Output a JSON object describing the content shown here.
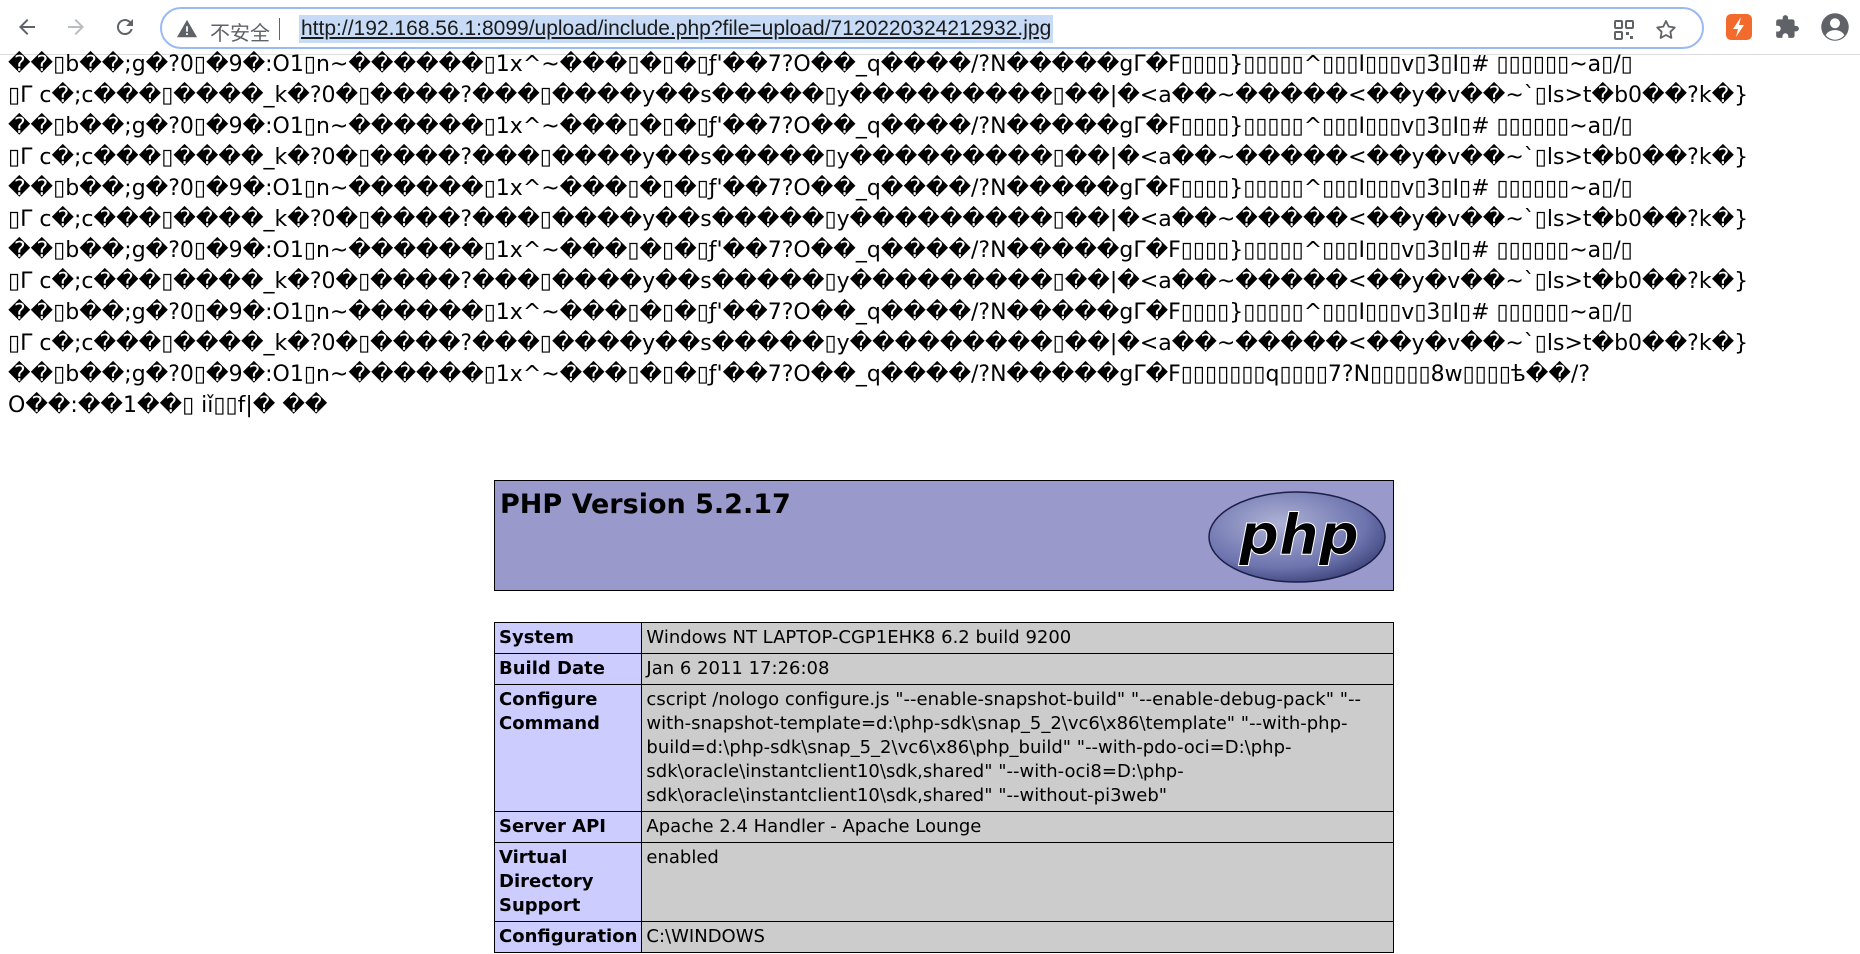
{
  "browser": {
    "insecure_label": "不安全",
    "url": "http://192.168.56.1:8099/upload/include.php?file=upload/7120220324212932.jpg",
    "icons": [
      "back-icon",
      "forward-icon",
      "reload-icon",
      "warning-icon",
      "qr-icon",
      "star-icon",
      "extension-flash-icon",
      "puzzle-icon",
      "account-icon"
    ],
    "colors": {
      "url_highlight": "#c7dbf7",
      "omnibox_border": "#9bb9f2",
      "ext_orange": "#f26b2c"
    }
  },
  "garbage_lines": [
    "��▯b��;g�?0▯�9�:O1▯n~������▯1x^~���▯�▯�▯ƒ'��7?O��_q����/?N�����gΓ�F▯▯▯▯}▯▯▯▯▯^▯▯▯I▯▯▯v▯3▯I▯# ▯▯▯▯▯▯~a▯/▯",
    "▯Γ c�;c���▯����_k�?0�▯����?���▯����y��s�����▯y���������▯��|�<a��~�����<��y�v��~`▯ls>t�b0��?k�}",
    "��▯b��;g�?0▯�9�:O1▯n~������▯1x^~���▯�▯�▯ƒ'��7?O��_q����/?N�����gΓ�F▯▯▯▯}▯▯▯▯▯^▯▯▯I▯▯▯v▯3▯I▯# ▯▯▯▯▯▯~a▯/▯",
    "▯Γ c�;c���▯����_k�?0�▯����?���▯����y��s�����▯y���������▯��|�<a��~�����<��y�v��~`▯ls>t�b0��?k�}",
    "��▯b��;g�?0▯�9�:O1▯n~������▯1x^~���▯�▯�▯ƒ'��7?O��_q����/?N�����gΓ�F▯▯▯▯}▯▯▯▯▯^▯▯▯I▯▯▯v▯3▯I▯# ▯▯▯▯▯▯~a▯/▯",
    "▯Γ c�;c���▯����_k�?0�▯����?���▯����y��s�����▯y���������▯��|�<a��~�����<��y�v��~`▯ls>t�b0��?k�}",
    "��▯b��;g�?0▯�9�:O1▯n~������▯1x^~���▯�▯�▯ƒ'��7?O��_q����/?N�����gΓ�F▯▯▯▯}▯▯▯▯▯^▯▯▯I▯▯▯v▯3▯I▯# ▯▯▯▯▯▯~a▯/▯",
    "▯Γ c�;c���▯����_k�?0�▯����?���▯����y��s�����▯y���������▯��|�<a��~�����<��y�v��~`▯ls>t�b0��?k�}",
    "��▯b��;g�?0▯�9�:O1▯n~������▯1x^~���▯�▯�▯ƒ'��7?O��_q����/?N�����gΓ�F▯▯▯▯}▯▯▯▯▯^▯▯▯I▯▯▯v▯3▯I▯# ▯▯▯▯▯▯~a▯/▯",
    "▯Γ c�;c���▯����_k�?0�▯����?���▯����y��s�����▯y���������▯��|�<a��~�����<��y�v��~`▯ls>t�b0��?k�}",
    "��▯b��;g�?0▯�9�:O1▯n~������▯1x^~���▯�▯�▯ƒ'��7?O��_q����/?N�����gΓ�F▯▯▯▯▯▯▯q▯▯▯▯7?N▯▯▯▯▯8w▯▯▯▯ѣ��/?",
    "O��:��1��▯ iǐ▯▯f|� ��"
  ],
  "phpinfo": {
    "version_title": "PHP Version 5.2.17",
    "logo_text": "php",
    "rows": [
      {
        "key": "System",
        "value": "Windows NT LAPTOP-CGP1EHK8 6.2 build 9200"
      },
      {
        "key": "Build Date",
        "value": "Jan 6 2011 17:26:08"
      },
      {
        "key": "Configure Command",
        "value": "cscript /nologo configure.js \"--enable-snapshot-build\" \"--enable-debug-pack\" \"--with-snapshot-template=d:\\php-sdk\\snap_5_2\\vc6\\x86\\template\" \"--with-php-build=d:\\php-sdk\\snap_5_2\\vc6\\x86\\php_build\" \"--with-pdo-oci=D:\\php-sdk\\oracle\\instantclient10\\sdk,shared\" \"--with-oci8=D:\\php-sdk\\oracle\\instantclient10\\sdk,shared\" \"--without-pi3web\""
      },
      {
        "key": "Server API",
        "value": "Apache 2.4 Handler - Apache Lounge"
      },
      {
        "key": "Virtual Directory Support",
        "value": "enabled"
      },
      {
        "key": "Configuration",
        "value": "C:\\WINDOWS"
      }
    ]
  }
}
